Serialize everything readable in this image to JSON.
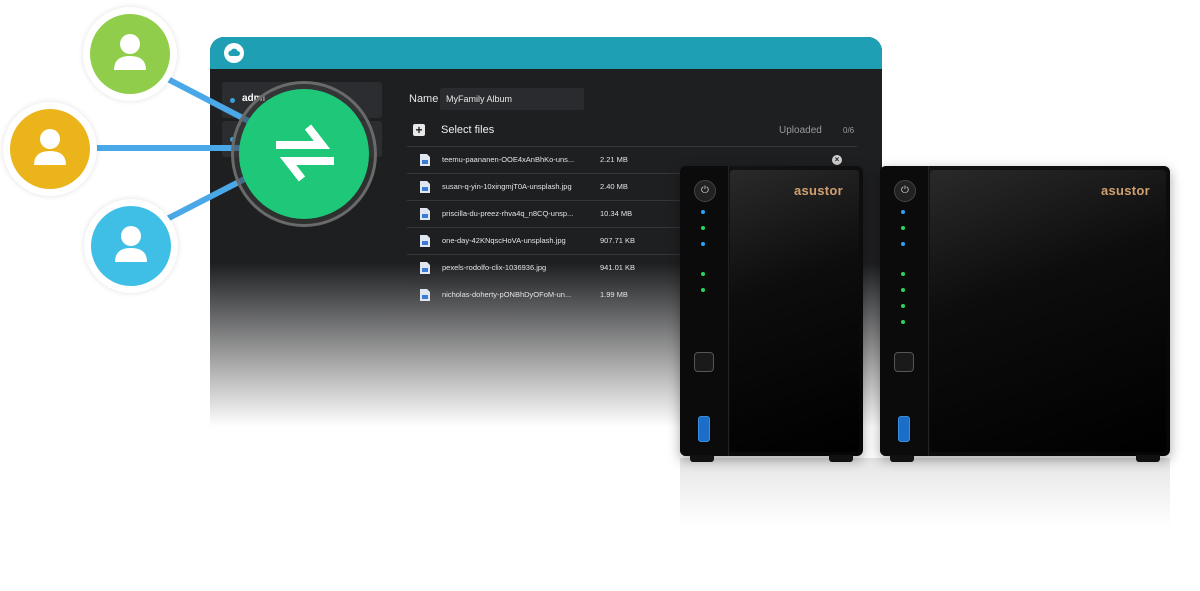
{
  "colors": {
    "titlebar": "#1f9fb3",
    "sync_button": "#1ec878",
    "user_green": "#8fcd4a",
    "user_yellow": "#eab41a",
    "user_blue": "#3fbfe6",
    "brand": "#d1a070"
  },
  "window": {
    "titlebar_icon": "cloud-icon",
    "sidebar": [
      {
        "label": "admi"
      },
      {
        "label": ""
      }
    ]
  },
  "form": {
    "name_label": "Name",
    "name_value": "MyFamily Album",
    "select_files_label": "Select files",
    "uploaded_label": "Uploaded",
    "uploaded_count": "0/6"
  },
  "files": [
    {
      "name": "teemu-paananen-OOE4xAnBhKo-uns...",
      "size": "2.21 MB"
    },
    {
      "name": "susan-q-yin-10xingmjT0A-unsplash.jpg",
      "size": "2.40 MB"
    },
    {
      "name": "priscilla-du-preez-rhva4q_n8CQ-unsp...",
      "size": "10.34 MB"
    },
    {
      "name": "one-day-42KNqscHoVA-unsplash.jpg",
      "size": "907.71 KB"
    },
    {
      "name": "pexels-rodolfo-clix-1036936.jpg",
      "size": "941.01 KB"
    },
    {
      "name": "nicholas-doherty-pONBhDyOFoM-un...",
      "size": "1.99 MB"
    }
  ],
  "users": [
    {
      "icon": "user-icon",
      "color": "#8fcd4a"
    },
    {
      "icon": "user-icon",
      "color": "#eab41a"
    },
    {
      "icon": "user-icon",
      "color": "#3fbfe6"
    }
  ],
  "sync_icon": "transfer-arrows-icon",
  "devices": [
    {
      "brand": "asustor"
    },
    {
      "brand": "asustor"
    }
  ]
}
